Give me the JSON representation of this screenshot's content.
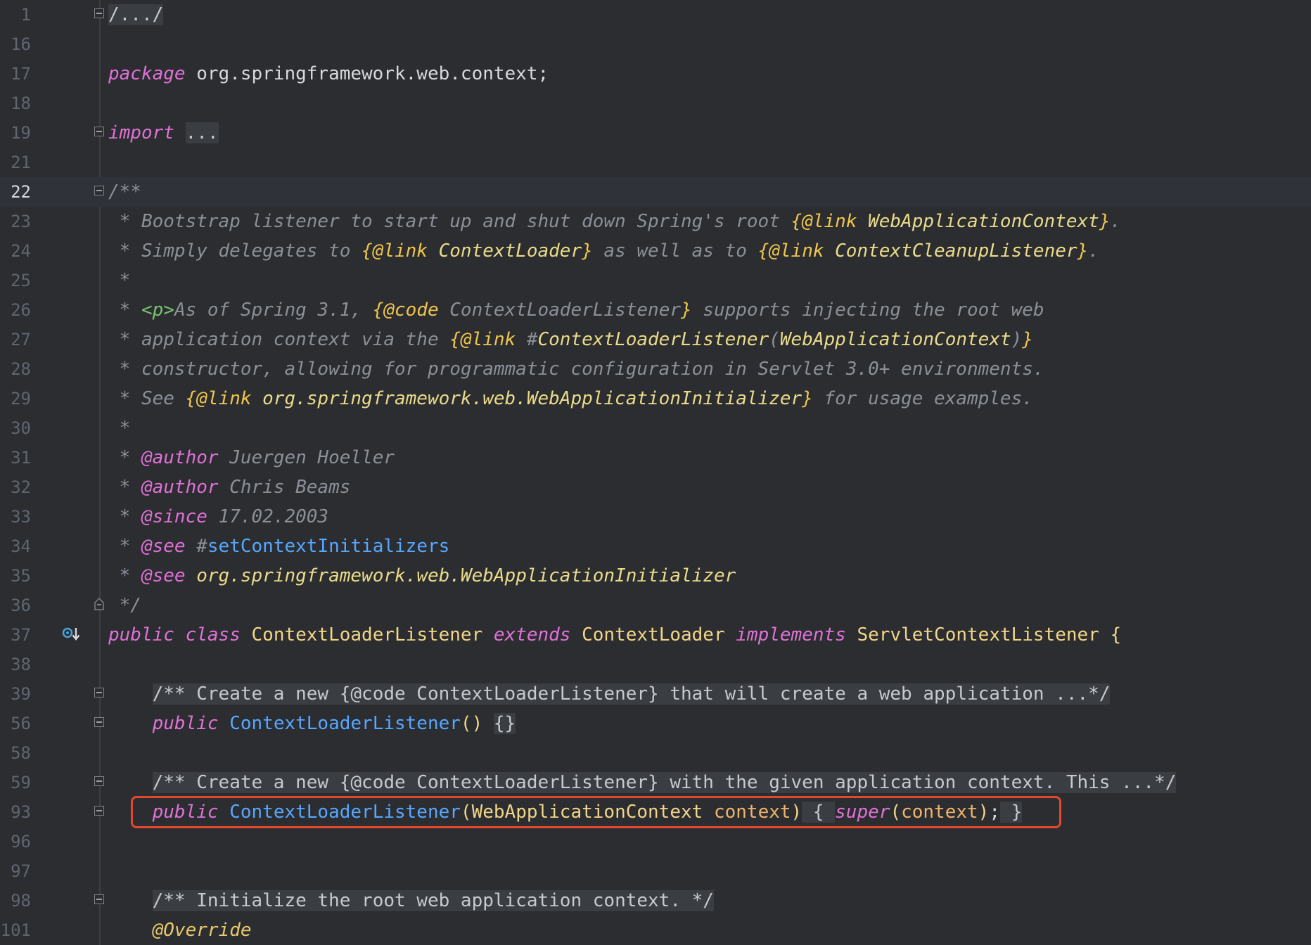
{
  "editor": {
    "lines": [
      {
        "num": "1",
        "tokens": [
          [
            "folded",
            "/.../"
          ]
        ],
        "fold": true
      },
      {
        "num": "16",
        "tokens": []
      },
      {
        "num": "17",
        "tokens": [
          [
            "kw",
            "package"
          ],
          [
            "plain",
            " org.springframework.web.context;"
          ]
        ]
      },
      {
        "num": "18",
        "tokens": []
      },
      {
        "num": "19",
        "tokens": [
          [
            "kw",
            "import"
          ],
          [
            "plain",
            " "
          ],
          [
            "folded",
            "..."
          ]
        ],
        "fold": true
      },
      {
        "num": "21",
        "tokens": []
      },
      {
        "num": "22",
        "tokens": [
          [
            "cmt",
            "/**"
          ]
        ],
        "fold": true,
        "current": true
      },
      {
        "num": "23",
        "tokens": [
          [
            "cmt",
            " * Bootstrap listener to start up and shut down Spring's root "
          ],
          [
            "tag",
            "{@link"
          ],
          [
            "ref",
            " WebApplicationContext"
          ],
          [
            "tag",
            "}"
          ],
          [
            "cmt",
            "."
          ]
        ]
      },
      {
        "num": "24",
        "tokens": [
          [
            "cmt",
            " * Simply delegates to "
          ],
          [
            "tag",
            "{@link"
          ],
          [
            "ref",
            " ContextLoader"
          ],
          [
            "tag",
            "}"
          ],
          [
            "cmt",
            " as well as to "
          ],
          [
            "tag",
            "{@link"
          ],
          [
            "ref",
            " ContextCleanupListener"
          ],
          [
            "tag",
            "}"
          ],
          [
            "cmt",
            "."
          ]
        ]
      },
      {
        "num": "25",
        "tokens": [
          [
            "cmt",
            " *"
          ]
        ]
      },
      {
        "num": "26",
        "tokens": [
          [
            "cmt",
            " * "
          ],
          [
            "html",
            "<p>"
          ],
          [
            "cmt",
            "As of Spring 3.1, "
          ],
          [
            "tag",
            "{@code"
          ],
          [
            "cmt",
            " ContextLoaderListener"
          ],
          [
            "tag",
            "}"
          ],
          [
            "cmt",
            " supports injecting the root web"
          ]
        ]
      },
      {
        "num": "27",
        "tokens": [
          [
            "cmt",
            " * application context via the "
          ],
          [
            "tag",
            "{@link"
          ],
          [
            "cmt",
            " #"
          ],
          [
            "ref",
            "ContextLoaderListener"
          ],
          [
            "cmt",
            "("
          ],
          [
            "ref",
            "WebApplicationContext"
          ],
          [
            "cmt",
            ")"
          ],
          [
            "tag",
            "}"
          ]
        ]
      },
      {
        "num": "28",
        "tokens": [
          [
            "cmt",
            " * constructor, allowing for programmatic configuration in Servlet 3.0+ environments."
          ]
        ]
      },
      {
        "num": "29",
        "tokens": [
          [
            "cmt",
            " * See "
          ],
          [
            "tag",
            "{@link"
          ],
          [
            "ref",
            " org.springframework.web.WebApplicationInitializer"
          ],
          [
            "tag",
            "}"
          ],
          [
            "cmt",
            " for usage examples."
          ]
        ]
      },
      {
        "num": "30",
        "tokens": [
          [
            "cmt",
            " *"
          ]
        ]
      },
      {
        "num": "31",
        "tokens": [
          [
            "cmt",
            " * "
          ],
          [
            "kw",
            "@author"
          ],
          [
            "cmt",
            " Juergen Hoeller"
          ]
        ]
      },
      {
        "num": "32",
        "tokens": [
          [
            "cmt",
            " * "
          ],
          [
            "kw",
            "@author"
          ],
          [
            "cmt",
            " Chris Beams"
          ]
        ]
      },
      {
        "num": "33",
        "tokens": [
          [
            "cmt",
            " * "
          ],
          [
            "kw",
            "@since"
          ],
          [
            "cmt",
            " 17.02.2003"
          ]
        ]
      },
      {
        "num": "34",
        "tokens": [
          [
            "cmt",
            " * "
          ],
          [
            "kw",
            "@see"
          ],
          [
            "cmt",
            " #"
          ],
          [
            "fn",
            "setContextInitializers"
          ]
        ]
      },
      {
        "num": "35",
        "tokens": [
          [
            "cmt",
            " * "
          ],
          [
            "kw",
            "@see"
          ],
          [
            "ref",
            " org.springframework.web.WebApplicationInitializer"
          ]
        ]
      },
      {
        "num": "36",
        "tokens": [
          [
            "cmt",
            " */"
          ]
        ],
        "foldEnd": true
      },
      {
        "num": "37",
        "tokens": [
          [
            "kw",
            "public"
          ],
          [
            "plain",
            " "
          ],
          [
            "kw",
            "class"
          ],
          [
            "type",
            " ContextLoaderListener"
          ],
          [
            "plain",
            " "
          ],
          [
            "kw",
            "extends"
          ],
          [
            "type",
            " ContextLoader"
          ],
          [
            "plain",
            " "
          ],
          [
            "kw",
            "implements"
          ],
          [
            "type",
            " ServletContextListener"
          ],
          [
            "plain",
            " "
          ],
          [
            "type",
            "{"
          ]
        ],
        "implIcon": true
      },
      {
        "num": "38",
        "tokens": []
      },
      {
        "num": "39",
        "tokens": [
          [
            "plain",
            "    "
          ],
          [
            "folded",
            "/** Create a new {@code ContextLoaderListener} that will create a web application ...*/"
          ]
        ],
        "fold": true
      },
      {
        "num": "56",
        "tokens": [
          [
            "plain",
            "    "
          ],
          [
            "kw",
            "public"
          ],
          [
            "fn",
            " ContextLoaderListener"
          ],
          [
            "type",
            "()"
          ],
          [
            "plain",
            " "
          ],
          [
            "folded",
            "{}"
          ]
        ],
        "fold": true
      },
      {
        "num": "58",
        "tokens": []
      },
      {
        "num": "59",
        "tokens": [
          [
            "plain",
            "    "
          ],
          [
            "folded",
            "/** Create a new {@code ContextLoaderListener} with the given application context. This ...*/"
          ]
        ],
        "fold": true
      },
      {
        "num": "93",
        "tokens": [
          [
            "plain",
            "    "
          ],
          [
            "kw",
            "public"
          ],
          [
            "fn",
            " ContextLoaderListener"
          ],
          [
            "type",
            "(WebApplicationContext"
          ],
          [
            "param",
            " context"
          ],
          [
            "type",
            ")"
          ],
          [
            "folded",
            " { "
          ],
          [
            "kw",
            "super"
          ],
          [
            "type",
            "("
          ],
          [
            "param",
            "context"
          ],
          [
            "type",
            ")"
          ],
          [
            "plain",
            ";"
          ],
          [
            "folded",
            " }"
          ]
        ],
        "fold": true
      },
      {
        "num": "96",
        "tokens": []
      },
      {
        "num": "97",
        "tokens": []
      },
      {
        "num": "98",
        "tokens": [
          [
            "plain",
            "    "
          ],
          [
            "folded",
            "/** Initialize the root web application context. */"
          ]
        ],
        "fold": true
      },
      {
        "num": "101",
        "tokens": [
          [
            "plain",
            "    "
          ],
          [
            "ann",
            "@Override"
          ]
        ]
      }
    ]
  },
  "colors": {
    "background": "#2b2d30",
    "keyword": "#e071d8",
    "comment": "#8b9098",
    "doc_tag": "#f0c64d",
    "method": "#57a7ff",
    "highlight_border": "#e4472d"
  },
  "icons": {
    "implemented": "implementation-marker-icon",
    "fold": "fold-toggle-icon"
  }
}
